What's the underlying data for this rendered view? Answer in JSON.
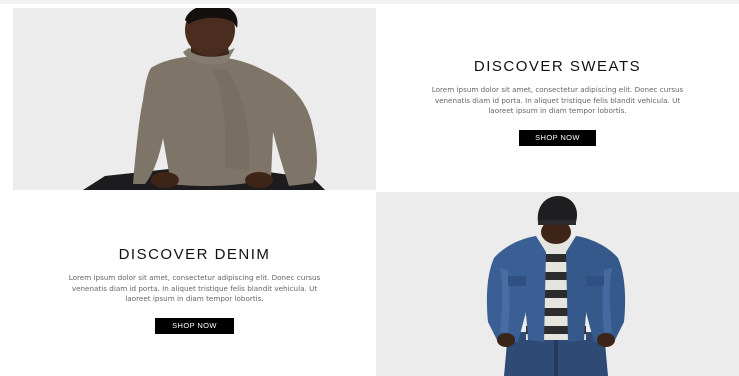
{
  "promos": [
    {
      "title": "DISCOVER SWEATS",
      "description": "Lorem ipsum dolor sit amet, consectetur adipiscing elit. Donec cursus venenatis diam id porta. In aliquet tristique felis blandit vehicula. Ut laoreet ipsum in diam tempor lobortis.",
      "button": "SHOP NOW",
      "image": "man-in-turtleneck-photo"
    },
    {
      "title": "DISCOVER DENIM",
      "description": "Lorem ipsum dolor sit amet, consectetur adipiscing elit. Donec cursus venenatis diam id porta. In aliquet tristique felis blandit vehicula. Ut laoreet ipsum in diam tempor lobortis.",
      "button": "SHOP NOW",
      "image": "man-in-denim-jacket-photo"
    }
  ],
  "colors": {
    "image_background": "#ececec",
    "button_background": "#000000",
    "button_text": "#ffffff"
  }
}
